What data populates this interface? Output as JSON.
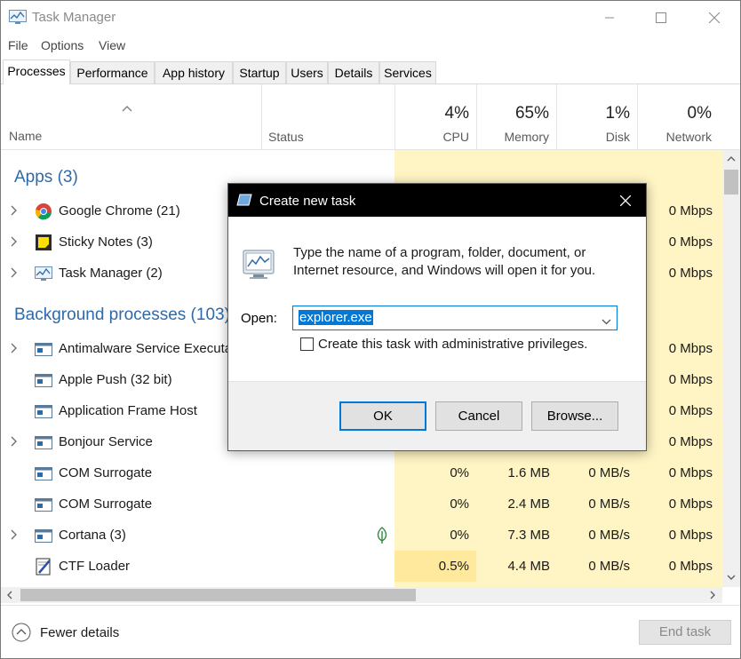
{
  "window": {
    "title": "Task Manager",
    "icon": "task-manager-icon"
  },
  "menu": [
    "File",
    "Options",
    "View"
  ],
  "tabs": [
    "Processes",
    "Performance",
    "App history",
    "Startup",
    "Users",
    "Details",
    "Services"
  ],
  "active_tab": "Processes",
  "columns": {
    "name": "Name",
    "status": "Status",
    "cpu": {
      "pct": "4%",
      "label": "CPU"
    },
    "memory": {
      "pct": "65%",
      "label": "Memory"
    },
    "disk": {
      "pct": "1%",
      "label": "Disk"
    },
    "network": {
      "pct": "0%",
      "label": "Network"
    }
  },
  "groups": {
    "apps": "Apps (3)",
    "background": "Background processes (103)"
  },
  "apps": [
    {
      "name": "Google Chrome (21)",
      "icon": "chrome-icon",
      "expandable": true,
      "cpu": "",
      "memory": "",
      "disk": "",
      "network": "0 Mbps"
    },
    {
      "name": "Sticky Notes (3)",
      "icon": "sticky-notes-icon",
      "expandable": true,
      "cpu": "",
      "memory": "",
      "disk": "",
      "network": "0 Mbps"
    },
    {
      "name": "Task Manager (2)",
      "icon": "task-manager-icon",
      "expandable": true,
      "cpu": "",
      "memory": "",
      "disk": "",
      "network": "0 Mbps"
    }
  ],
  "background": [
    {
      "name": "Antimalware Service Executable",
      "icon": "service-icon",
      "expandable": true,
      "cpu": "",
      "memory": "",
      "disk": "",
      "network": "0 Mbps"
    },
    {
      "name": "Apple Push (32 bit)",
      "icon": "service-icon",
      "expandable": false,
      "cpu": "",
      "memory": "",
      "disk": "",
      "network": "0 Mbps"
    },
    {
      "name": "Application Frame Host",
      "icon": "service-icon",
      "expandable": false,
      "cpu": "",
      "memory": "",
      "disk": "",
      "network": "0 Mbps"
    },
    {
      "name": "Bonjour Service",
      "icon": "service-icon",
      "expandable": true,
      "cpu": "",
      "memory": "",
      "disk": "",
      "network": "0 Mbps"
    },
    {
      "name": "COM Surrogate",
      "icon": "service-icon",
      "expandable": false,
      "cpu": "0%",
      "memory": "1.6 MB",
      "disk": "0 MB/s",
      "network": "0 Mbps"
    },
    {
      "name": "COM Surrogate",
      "icon": "service-icon",
      "expandable": false,
      "cpu": "0%",
      "memory": "2.4 MB",
      "disk": "0 MB/s",
      "network": "0 Mbps"
    },
    {
      "name": "Cortana (3)",
      "icon": "cortana-icon",
      "expandable": true,
      "status_icon": "leaf-icon",
      "cpu": "0%",
      "memory": "7.3 MB",
      "disk": "0 MB/s",
      "network": "0 Mbps"
    },
    {
      "name": "CTF Loader",
      "icon": "ctf-loader-icon",
      "expandable": false,
      "cpu": "0.5%",
      "memory": "4.4 MB",
      "disk": "0 MB/s",
      "network": "0 Mbps"
    }
  ],
  "footer": {
    "fewer_details": "Fewer details",
    "end_task": "End task"
  },
  "dialog": {
    "title": "Create new task",
    "description": "Type the name of a program, folder, document, or Internet resource, and Windows will open it for you.",
    "open_label": "Open:",
    "open_value": "explorer.exe",
    "admin_checkbox_label": "Create this task with administrative privileges.",
    "admin_checked": false,
    "ok": "OK",
    "cancel": "Cancel",
    "browse": "Browse..."
  },
  "colors": {
    "accent": "#0078d7",
    "group_heading": "#2f6aa8",
    "heat_light": "#fff4c4",
    "heat_medium": "#ffe99c"
  }
}
